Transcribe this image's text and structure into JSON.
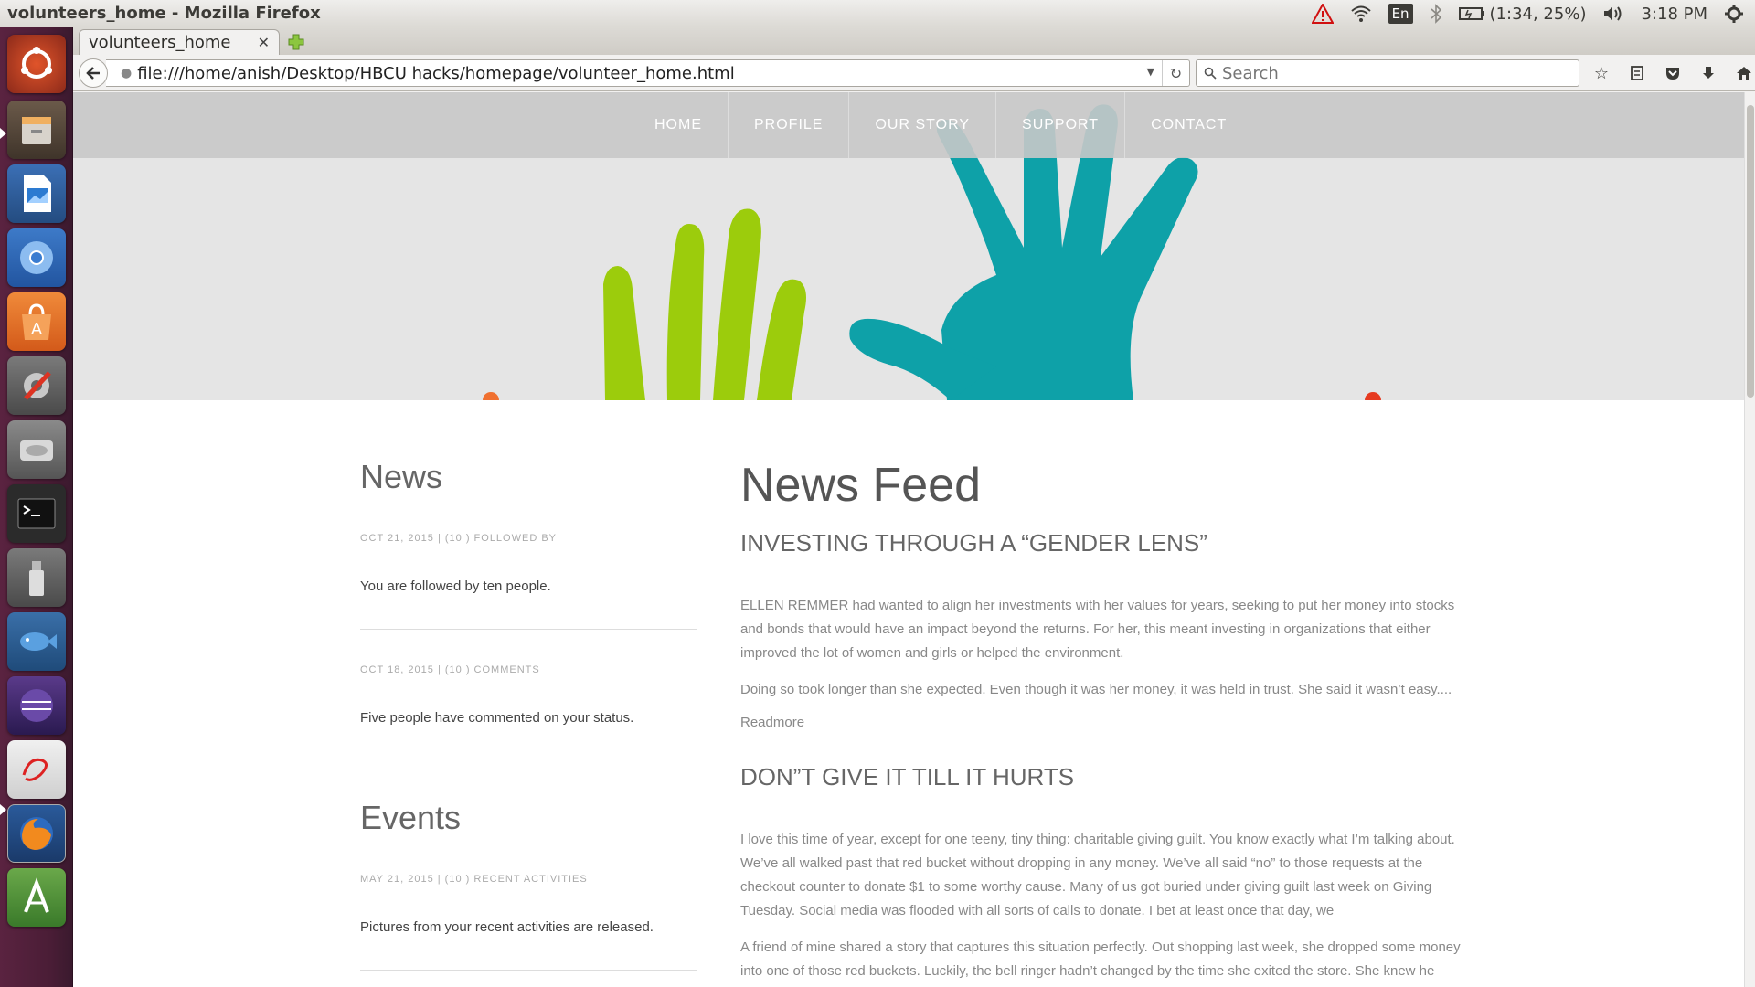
{
  "window": {
    "title": "volunteers_home - Mozilla Firefox"
  },
  "indicators": {
    "keyboard": "En",
    "battery": "(1:34, 25%)",
    "time": "3:18 PM"
  },
  "launcher": {
    "apps": [
      "dash-home",
      "files",
      "libreoffice-impress",
      "chromium",
      "software-center",
      "system-settings",
      "disk",
      "terminal",
      "usb-drive",
      "fish-app",
      "eclipse",
      "sketch-app",
      "firefox",
      "dev-tool"
    ]
  },
  "browser": {
    "tab_title": "volunteers_home",
    "url": "file:///home/anish/Desktop/HBCU hacks/homepage/volunteer_home.html",
    "search_placeholder": "Search"
  },
  "site": {
    "nav": [
      "HOME",
      "PROFILE",
      "OUR STORY",
      "SUPPORT",
      "CONTACT"
    ],
    "left": {
      "news_title": "News",
      "news": [
        {
          "meta": "OCT 21, 2015 | (10 ) FOLLOWED BY",
          "text": "You are followed by ten people."
        },
        {
          "meta": "OCT 18, 2015 | (10 ) COMMENTS",
          "text": "Five people have commented on your status."
        }
      ],
      "events_title": "Events",
      "events": [
        {
          "meta": "MAY 21, 2015 | (10 ) RECENT ACTIVITIES",
          "text": "Pictures from your recent activities are released."
        }
      ]
    },
    "feed": {
      "title": "News Feed",
      "articles": [
        {
          "title": "INVESTING THROUGH A “GENDER LENS”",
          "paragraphs": [
            "ELLEN REMMER had wanted to align her investments with her values for years, seeking to put her money into stocks and bonds that would have an impact beyond the returns. For her, this meant investing in organizations that either improved the lot of women and girls or helped the environment.",
            "Doing so took longer than she expected. Even though it was her money, it was held in trust. She said it wasn’t easy...."
          ],
          "readmore": "Readmore"
        },
        {
          "title": "DON”T GIVE IT TILL IT HURTS",
          "paragraphs": [
            "I love this time of year, except for one teeny, tiny thing: charitable giving guilt. You know exactly what I’m talking about. We’ve all walked past that red bucket without dropping in any money. We’ve all said “no” to those requests at the checkout counter to donate $1 to some worthy cause. Many of us got buried under giving guilt last week on Giving Tuesday. Social media was flooded with all sorts of calls to donate. I bet at least once that day, we",
            "A friend of mine shared a story that captures this situation perfectly. Out shopping last week, she dropped some money into one of those red buckets. Luckily, the bell ringer hadn’t changed by the time she exited the store. She knew he"
          ]
        }
      ]
    }
  }
}
